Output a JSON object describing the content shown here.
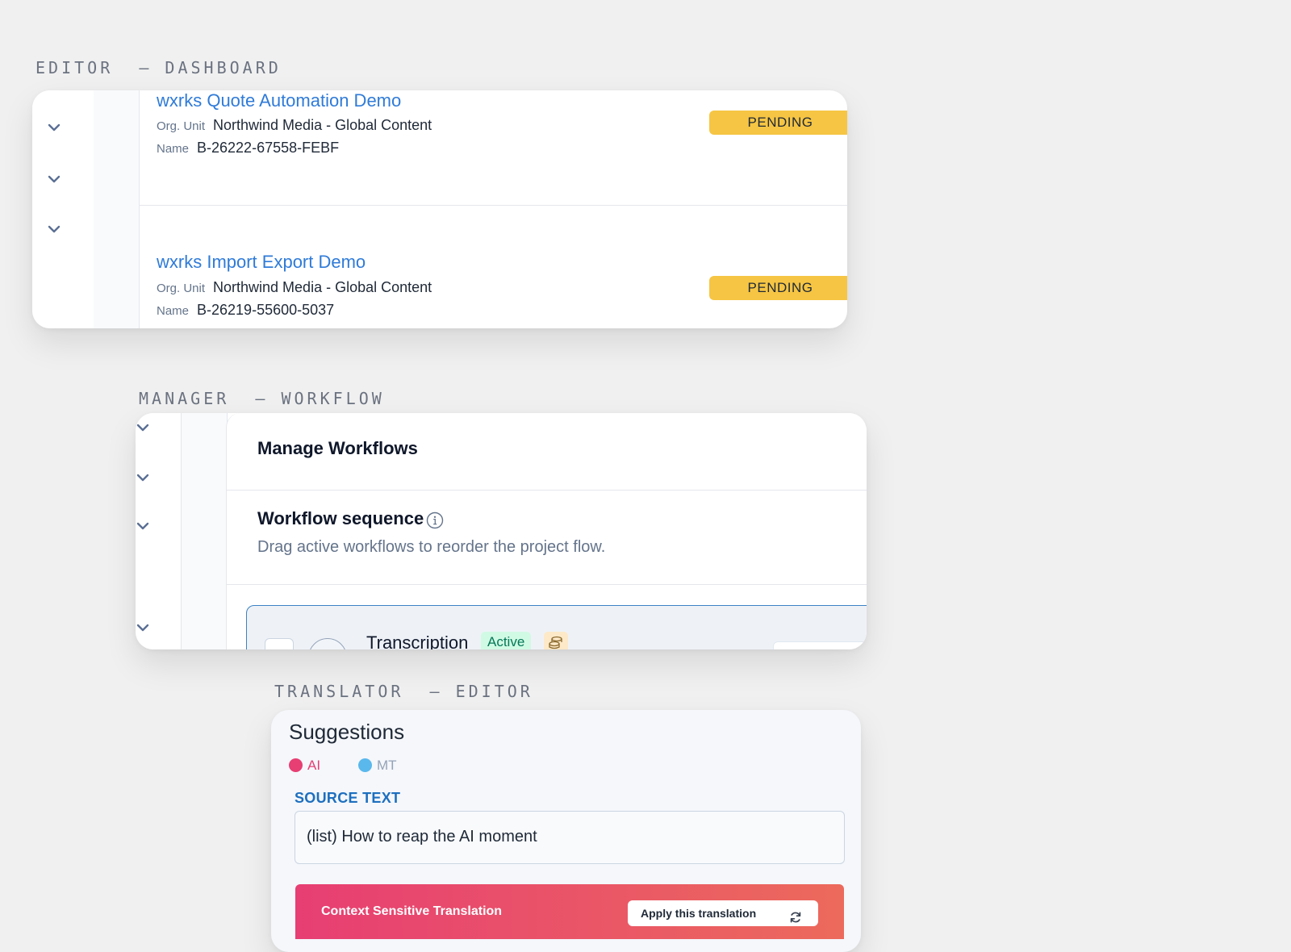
{
  "sections": {
    "editor": {
      "label": "EDITOR  — DASHBOARD"
    },
    "manager": {
      "label": "MANAGER  — WORKFLOW"
    },
    "translator": {
      "label": "TRANSLATOR  — EDITOR"
    }
  },
  "dashboard": {
    "rows": [
      {
        "title": "wxrks Quote Automation Demo",
        "org_unit_label": "Org. Unit",
        "org_unit": "Northwind Media - Global Content",
        "name_label": "Name",
        "name": "B-26222-67558-FEBF",
        "status": "PENDING"
      },
      {
        "title": "wxrks Import Export Demo",
        "org_unit_label": "Org. Unit",
        "org_unit": "Northwind Media - Global Content",
        "name_label": "Name",
        "name": "B-26219-55600-5037",
        "status": "PENDING"
      }
    ],
    "status_color": "#f6c543",
    "link_color": "#2f7bd8"
  },
  "workflow": {
    "header": "Manage Workflows",
    "sequence_title": "Workflow sequence",
    "sequence_hint": "Drag active workflows to reorder the project flow.",
    "item": {
      "name": "Transcription",
      "status": "Active"
    }
  },
  "editor": {
    "suggestions_title": "Suggestions",
    "legend": [
      {
        "label": "AI",
        "color": "#e73e73"
      },
      {
        "label": "MT",
        "color": "#5ab8ec"
      }
    ],
    "source_label": "SOURCE TEXT",
    "source_text": "(list) How to reap the AI moment",
    "cst_title": "Context Sensitive Translation",
    "apply_label": "Apply this translation"
  }
}
